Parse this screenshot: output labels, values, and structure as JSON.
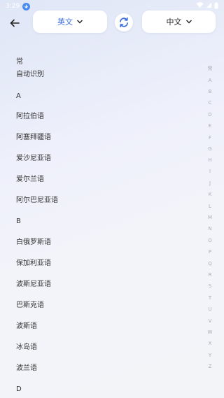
{
  "status_bar": {
    "time": "3:29"
  },
  "header": {
    "source_language": "英文",
    "target_language": "中文"
  },
  "sections": [
    {
      "header": "常",
      "items": [
        "自动识别"
      ]
    },
    {
      "header": "A",
      "items": [
        "阿拉伯语",
        "阿塞拜疆语",
        "爱沙尼亚语",
        "爱尔兰语",
        "阿尔巴尼亚语"
      ]
    },
    {
      "header": "B",
      "items": [
        "白俄罗斯语",
        "保加利亚语",
        "波斯尼亚语",
        "巴斯克语",
        "波斯语",
        "冰岛语",
        "波兰语"
      ]
    },
    {
      "header": "D",
      "items": []
    }
  ],
  "index_bar": [
    "常",
    "A",
    "B",
    "C",
    "D",
    "E",
    "F",
    "G",
    "H",
    "I",
    "J",
    "K",
    "L",
    "M",
    "N",
    "O",
    "P",
    "Q",
    "R",
    "S",
    "T",
    "U",
    "V",
    "W",
    "X",
    "Y",
    "Z"
  ],
  "colors": {
    "accent": "#3f6fe0",
    "swap_icon": "#3f6fe0",
    "index_text": "#a7acb8"
  }
}
